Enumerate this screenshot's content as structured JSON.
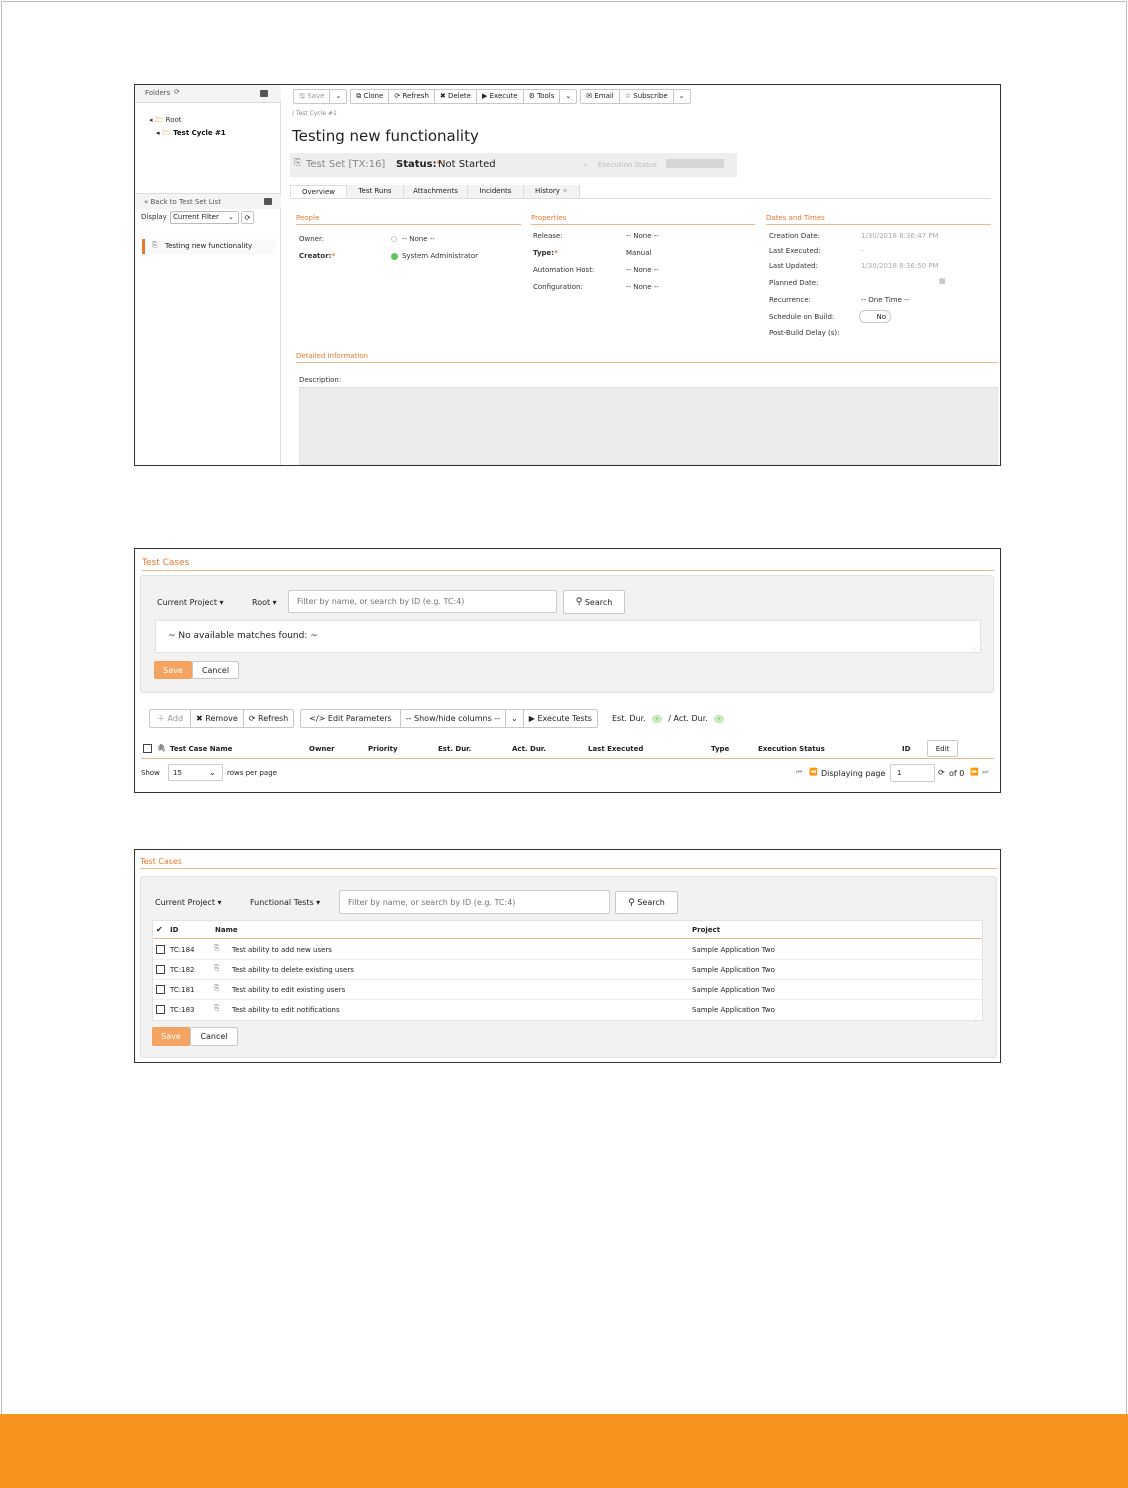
{
  "shot1": {
    "folders_label": "Folders",
    "tree": [
      "Root",
      "Test Cycle #1"
    ],
    "back_link": "« Back to Test Set List",
    "display_label": "Display",
    "display_value": "Current Filter",
    "list_item": "Testing new functionality",
    "toolbar": {
      "save": "Save",
      "clone": "Clone",
      "refresh": "Refresh",
      "delete": "Delete",
      "execute": "Execute",
      "tools": "Tools",
      "email": "Email",
      "subscribe": "Subscribe"
    },
    "breadcrumb": "/ Test Cycle #1",
    "title": "Testing new functionality",
    "test_set_id": "Test Set [TX:16]",
    "status_label": "Status:",
    "status_value": "Not Started",
    "execution_status_label": "Execution Status",
    "tabs": [
      "Overview",
      "Test Runs",
      "Attachments",
      "Incidents",
      "History"
    ],
    "people": {
      "title": "People",
      "owner_label": "Owner:",
      "owner_value": "-- None --",
      "creator_label": "Creator:",
      "creator_value": "System Administrator"
    },
    "properties": {
      "title": "Properties",
      "release_label": "Release:",
      "release_value": "-- None --",
      "type_label": "Type:",
      "type_value": "Manual",
      "host_label": "Automation Host:",
      "host_value": "-- None --",
      "config_label": "Configuration:",
      "config_value": "-- None --"
    },
    "dates": {
      "title": "Dates and Times",
      "creation_label": "Creation Date:",
      "creation_value": "1/30/2018 8:36:47 PM",
      "executed_label": "Last Executed:",
      "executed_value": "-",
      "updated_label": "Last Updated:",
      "updated_value": "1/30/2018 8:36:50 PM",
      "planned_label": "Planned Date:",
      "recurrence_label": "Recurrence:",
      "recurrence_value": "-- One Time --",
      "schedule_label": "Schedule on Build:",
      "schedule_value": "No",
      "delay_label": "Post-Build Delay (s):"
    },
    "detailed_title": "Detailed Information",
    "description_label": "Description:"
  },
  "shot2": {
    "title": "Test Cases",
    "project_dd": "Current Project",
    "folder_dd": "Root",
    "search_placeholder": "Filter by name, or search by ID (e.g. TC:4)",
    "search_btn": "Search",
    "no_matches": "~ No available matches found: ~",
    "save": "Save",
    "cancel": "Cancel",
    "toolbar": {
      "add": "Add",
      "remove": "Remove",
      "refresh": "Refresh",
      "edit_params": "Edit Parameters",
      "show_hide": "-- Show/hide columns --",
      "execute": "Execute Tests",
      "est_dur": "Est. Dur.",
      "act_dur": "/ Act. Dur.",
      "dash": "-"
    },
    "columns": [
      "Test Case Name",
      "Owner",
      "Priority",
      "Est. Dur.",
      "Act. Dur.",
      "Last Executed",
      "Type",
      "Execution Status",
      "ID"
    ],
    "edit_btn": "Edit",
    "show_label": "Show",
    "page_size": "15",
    "rows_per_page": "rows per page",
    "displaying_page": "Displaying page",
    "page_value": "1",
    "of_pages": "of 0"
  },
  "shot3": {
    "title": "Test Cases",
    "project_dd": "Current Project",
    "folder_dd": "Functional Tests",
    "search_placeholder": "Filter by name, or search by ID (e.g. TC:4)",
    "search_btn": "Search",
    "col_id": "ID",
    "col_name": "Name",
    "col_project": "Project",
    "rows": [
      {
        "id": "TC:184",
        "name": "Test ability to add new users",
        "project": "Sample Application Two"
      },
      {
        "id": "TC:182",
        "name": "Test ability to delete existing users",
        "project": "Sample Application Two"
      },
      {
        "id": "TC:181",
        "name": "Test ability to edit existing users",
        "project": "Sample Application Two"
      },
      {
        "id": "TC:183",
        "name": "Test ability to edit notifications",
        "project": "Sample Application Two"
      }
    ],
    "save": "Save",
    "cancel": "Cancel"
  },
  "colors": {
    "accent": "#e8792b",
    "footer": "#f7941d",
    "save_button": "#f4a460"
  }
}
